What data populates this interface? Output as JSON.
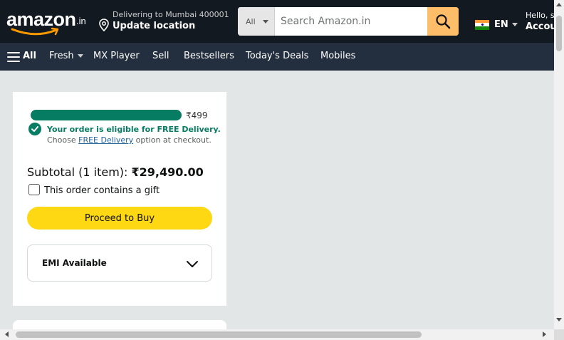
{
  "header": {
    "logo_text": "amazon",
    "logo_suffix": ".in",
    "deliver_line1": "Delivering to Mumbai 400001",
    "deliver_line2": "Update location",
    "search_category": "All",
    "search_placeholder": "Search Amazon.in",
    "language": "EN",
    "account_line1": "Hello, s",
    "account_line2": "Accou"
  },
  "subnav": {
    "all_label": "All",
    "items": [
      "Fresh",
      "MX Player",
      "Sell",
      "Bestsellers",
      "Today's Deals",
      "Mobiles"
    ]
  },
  "cart": {
    "progress_fraction": 1.0,
    "progress_caption": "₹499",
    "free_line1": "Your order is eligible for FREE Delivery.",
    "free_prefix": "Choose",
    "free_link": "FREE Delivery",
    "free_suffix": "option at checkout.",
    "subtotal_label": "Subtotal (1 item):",
    "subtotal_value": "₹29,490.00",
    "gift_label": "This order contains a gift",
    "gift_checked": false,
    "buy_label": "Proceed to Buy",
    "emi_label": "EMI Available"
  },
  "colors": {
    "nav_bg": "#131921",
    "subnav_bg": "#232f3e",
    "search_button": "#febd69",
    "progress": "#067d62",
    "buy_button": "#ffd814",
    "link": "#2162a1"
  },
  "icons": {
    "location": "location-pin-icon",
    "search": "search-icon",
    "menu": "hamburger-menu-icon",
    "check": "check-circle-icon",
    "emi_toggle": "chevron-down-icon"
  }
}
